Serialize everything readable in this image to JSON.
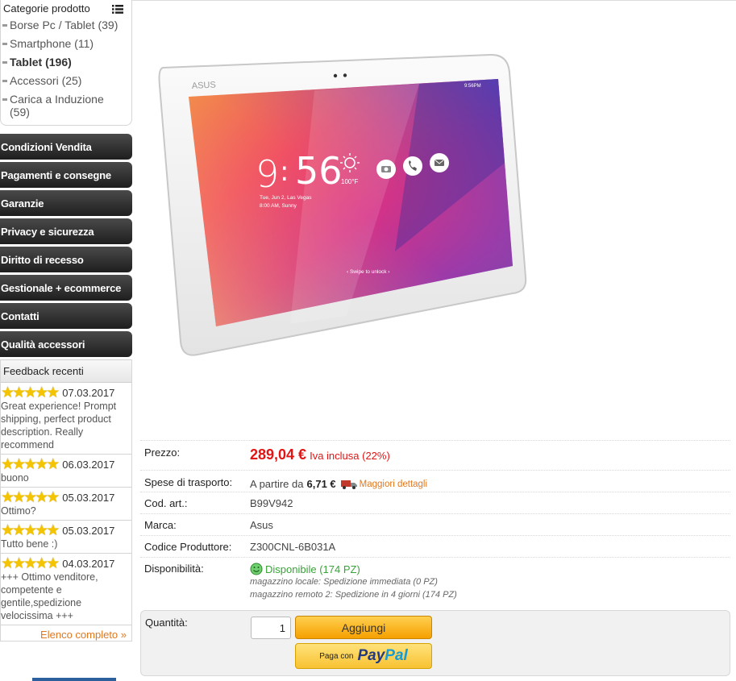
{
  "sidebar": {
    "categories": {
      "title": "Categorie prodotto",
      "menu_icon": "list-icon",
      "items": [
        {
          "label": "Borse Pc / Tablet (39)"
        },
        {
          "label": "Smartphone (11)"
        },
        {
          "label": "Tablet (196)"
        },
        {
          "label": "Accessori (25)"
        },
        {
          "label": "Carica a Induzione (59)"
        }
      ]
    },
    "nav": [
      "Condizioni Vendita",
      "Pagamenti e consegne",
      "Garanzie",
      "Privacy e sicurezza",
      "Diritto di recesso",
      "Gestionale + ecommerce",
      "Contatti",
      "Qualità accessori"
    ],
    "feedback": {
      "title": "Feedback recenti",
      "items": [
        {
          "rating": 5,
          "date": "07.03.2017",
          "text": "Great experience! Prompt shipping, perfect product description. Really recommend"
        },
        {
          "rating": 5,
          "date": "06.03.2017",
          "text": "buono"
        },
        {
          "rating": 5,
          "date": "05.03.2017",
          "text": "Ottimo?"
        },
        {
          "rating": 5,
          "date": "05.03.2017",
          "text": "Tutto bene :)"
        },
        {
          "rating": 5,
          "date": "04.03.2017",
          "text": "+++ Ottimo venditore, competente e gentile,spedizione velocissima +++"
        }
      ],
      "more_link": "Elenco completo »"
    }
  },
  "product": {
    "image_screen": {
      "brand": "ASUS",
      "clock_hour": "9",
      "clock_min": "56",
      "temp": "100°F",
      "date_line": "Tue, Jun 2, Las Vegas",
      "alarm_line": "8:00 AM, Sunny",
      "status_time": "9:56PM",
      "unlock_hint": "‹ Swipe to unlock ›"
    },
    "price_label": "Prezzo:",
    "price": "289,04 €",
    "vat_text": "Iva inclusa (22%)",
    "shipping_label": "Spese di trasporto:",
    "shipping_prefix": "A partire da",
    "shipping_cost": "6,71 €",
    "shipping_more": "Maggiori dettagli",
    "code_label": "Cod. art.:",
    "code": "B99V942",
    "brand_label": "Marca:",
    "brand": "Asus",
    "mpn_label": "Codice Produttore:",
    "mpn": "Z300CNL-6B031A",
    "availability_label": "Disponibilità:",
    "availability": "Disponibile (174 PZ)",
    "stock_local": "magazzino locale: Spedizione immediata (0 PZ)",
    "stock_remote": "magazzino remoto 2: Spedizione in 4 giorni (174 PZ)"
  },
  "cart": {
    "qty_label": "Quantità:",
    "qty_value": "1",
    "add_label": "Aggiungi",
    "paypal_prefix": "Paga con",
    "paypal_pay": "Pay",
    "paypal_pal": "Pal"
  },
  "colors": {
    "price": "#e31414",
    "available": "#3aa23a",
    "link": "#e07820",
    "button": "#f5a000"
  }
}
